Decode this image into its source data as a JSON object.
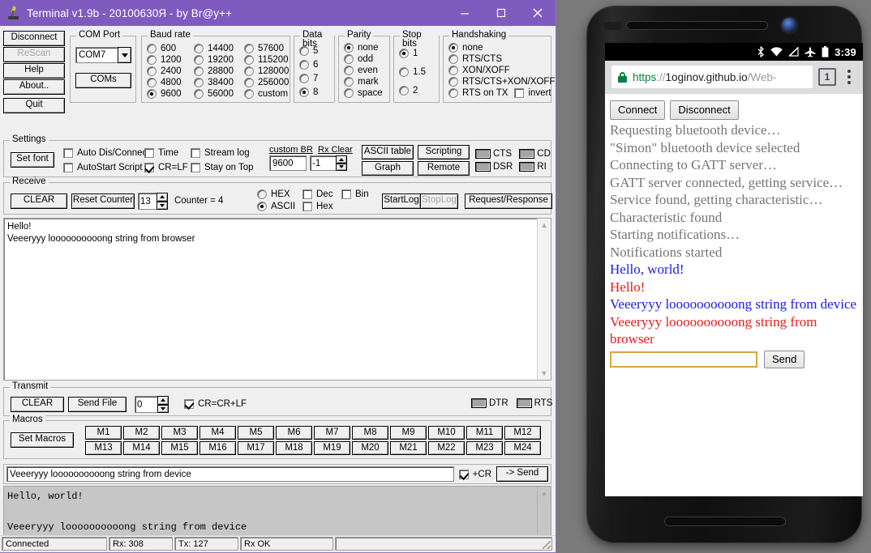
{
  "terminal": {
    "title": "Terminal v1.9b - 20100630Я - by Br@y++",
    "title_icon": "microscope-icon",
    "window_controls": {
      "minimize": "minimize-icon",
      "maximize": "maximize-icon",
      "close": "close-icon"
    },
    "left_buttons": [
      {
        "label": "Disconnect",
        "name": "disconnect-button",
        "disabled": false
      },
      {
        "label": "ReScan",
        "name": "rescan-button",
        "disabled": true
      },
      {
        "label": "Help",
        "name": "help-button",
        "disabled": false
      },
      {
        "label": "About..",
        "name": "about-button",
        "disabled": false
      },
      {
        "label": "Quit",
        "name": "quit-button",
        "disabled": false
      }
    ],
    "com_port": {
      "legend": "COM Port",
      "selected": "COM7",
      "coms_button": "COMs"
    },
    "baud_rate": {
      "legend": "Baud rate",
      "selected": "9600",
      "col1": [
        "600",
        "1200",
        "2400",
        "4800",
        "9600"
      ],
      "col2": [
        "14400",
        "19200",
        "28800",
        "38400",
        "56000"
      ],
      "col3": [
        "57600",
        "115200",
        "128000",
        "256000",
        "custom"
      ]
    },
    "data_bits": {
      "legend": "Data bits",
      "options": [
        "5",
        "6",
        "7",
        "8"
      ],
      "selected": "8"
    },
    "parity": {
      "legend": "Parity",
      "options": [
        "none",
        "odd",
        "even",
        "mark",
        "space"
      ],
      "selected": "none"
    },
    "stop_bits": {
      "legend": "Stop bits",
      "options": [
        "1",
        "1.5",
        "2"
      ],
      "selected": "1"
    },
    "handshaking": {
      "legend": "Handshaking",
      "options": [
        "none",
        "RTS/CTS",
        "XON/XOFF",
        "RTS/CTS+XON/XOFF",
        "RTS on TX"
      ],
      "selected": "none",
      "invert_label": "invert",
      "invert_checked": false
    },
    "settings": {
      "legend": "Settings",
      "set_font": "Set font",
      "checks": [
        {
          "label": "Auto Dis/Connect",
          "checked": false
        },
        {
          "label": "AutoStart Script",
          "checked": false
        },
        {
          "label": "Time",
          "checked": false
        },
        {
          "label": "CR=LF",
          "checked": true
        },
        {
          "label": "Stream log",
          "checked": false
        },
        {
          "label": "Stay on Top",
          "checked": false
        }
      ],
      "custom_br_label": "custom BR",
      "custom_br_value": "9600",
      "rx_clear_label": "Rx Clear",
      "rx_clear_value": "-1",
      "buttons": [
        "ASCII table",
        "Scripting",
        "Graph",
        "Remote"
      ],
      "leds": [
        "CTS",
        "CD",
        "DSR",
        "RI"
      ]
    },
    "receive": {
      "legend": "Receive",
      "clear": "CLEAR",
      "reset_counter": "Reset Counter",
      "counter_spin_value": "13",
      "counter_text": "Counter = 4",
      "radios": [
        "HEX",
        "ASCII"
      ],
      "radio_selected": "ASCII",
      "checks": [
        {
          "label": "Dec",
          "checked": false
        },
        {
          "label": "Hex",
          "checked": false
        },
        {
          "label": "Bin",
          "checked": false
        }
      ],
      "start_log": "StartLog",
      "stop_log": "StopLog",
      "request_response": "Request/Response",
      "lines": [
        "Hello!",
        "Veeeryyy loooooooooong string from browser"
      ]
    },
    "transmit": {
      "legend": "Transmit",
      "clear": "CLEAR",
      "send_file": "Send File",
      "delay_value": "0",
      "crcrlf_label": "CR=CR+LF",
      "crcrlf_checked": true,
      "leds": [
        "DTR",
        "RTS"
      ]
    },
    "macros": {
      "legend": "Macros",
      "set_macros": "Set Macros",
      "row1": [
        "M1",
        "M2",
        "M3",
        "M4",
        "M5",
        "M6",
        "M7",
        "M8",
        "M9",
        "M10",
        "M11",
        "M12"
      ],
      "row2": [
        "M13",
        "M14",
        "M15",
        "M16",
        "M17",
        "M18",
        "M19",
        "M20",
        "M21",
        "M22",
        "M23",
        "M24"
      ]
    },
    "send_row": {
      "input_value": "Veeeryyy loooooooooong string from device",
      "cr_label": "+CR",
      "cr_checked": true,
      "send_label": "-> Send"
    },
    "console_lines": [
      "Hello, world!",
      "",
      "Veeeryyy loooooooooong string from device"
    ],
    "status": {
      "connection": "Connected",
      "rx": "Rx: 308",
      "tx": "Tx: 127",
      "rx_ok": "Rx OK",
      "extra": ""
    }
  },
  "phone": {
    "status_bar": {
      "icons": [
        "bluetooth-icon",
        "wifi-icon",
        "signal-off-icon",
        "airplane-mode-icon",
        "battery-icon"
      ],
      "clock": "3:39"
    },
    "browser": {
      "lock_icon": "lock-icon",
      "url_scheme": "https",
      "url_sep": "://",
      "url_domain": "1oginov.github.io",
      "url_path": "/Web-",
      "tab_count": "1",
      "menu_icon": "overflow-menu-icon"
    },
    "page": {
      "connect_label": "Connect",
      "disconnect_label": "Disconnect",
      "log": [
        {
          "text": "Requesting bluetooth device…",
          "kind": "info"
        },
        {
          "text": "\"Simon\" bluetooth device selected",
          "kind": "info"
        },
        {
          "text": "Connecting to GATT server…",
          "kind": "info"
        },
        {
          "text": "GATT server connected, getting service…",
          "kind": "info"
        },
        {
          "text": "Service found, getting characteristic…",
          "kind": "info"
        },
        {
          "text": "Characteristic found",
          "kind": "info"
        },
        {
          "text": "Starting notifications…",
          "kind": "info"
        },
        {
          "text": "Notifications started",
          "kind": "info"
        },
        {
          "text": "Hello, world!",
          "kind": "device"
        },
        {
          "text": "Hello!",
          "kind": "browser"
        },
        {
          "text": "Veeeryyy loooooooooong string from device",
          "kind": "device"
        },
        {
          "text": "Veeeryyy loooooooooong string from browser",
          "kind": "browser"
        }
      ],
      "input_value": "",
      "send_label": "Send"
    }
  },
  "colors": {
    "titlebar": "#7f5bbf",
    "device_text": "#1a1ae8",
    "browser_text": "#e81a1a",
    "info_text": "#757575",
    "lock_green": "#0b8043",
    "input_focus": "#d9a441"
  }
}
